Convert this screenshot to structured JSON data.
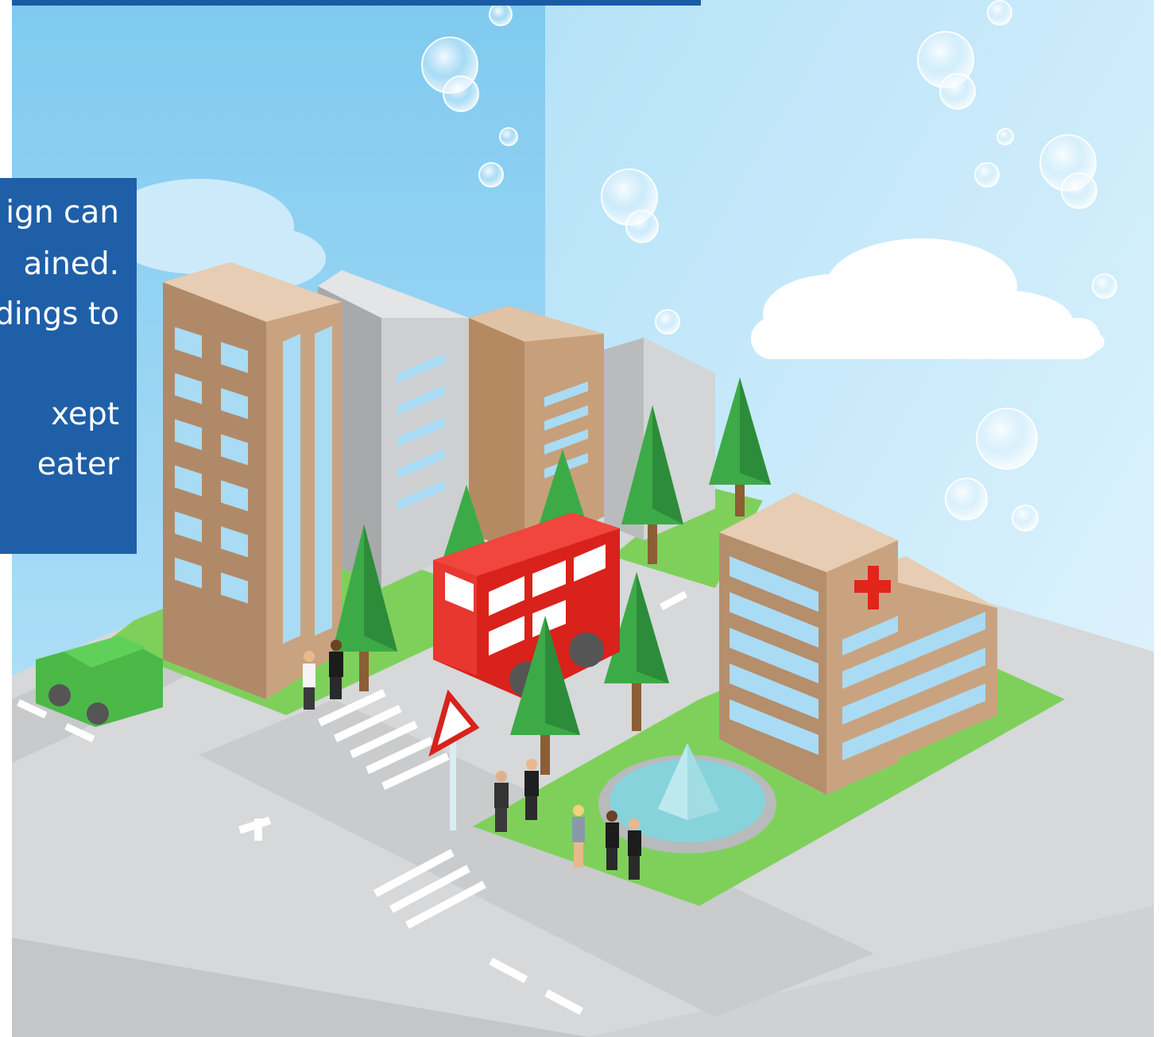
{
  "colors": {
    "sky_top": "#8fd2f2",
    "sky_bottom": "#d2eefb",
    "ground": "#d4d6d8",
    "ground_dark": "#bfc2c5",
    "road": "#c9cbcd",
    "grass": "#7dd05a",
    "bus_red": "#e32b23",
    "car_green": "#4cb848",
    "tree_green": "#3cab47",
    "building_tan": "#c49c78",
    "building_gray": "#cfd0d2",
    "window_blue": "#a8daf5",
    "text_box_blue": "#1f5fa8",
    "top_band_blue": "#1a5ba6",
    "cross_red": "#e1251b",
    "fountain_water": "#88d4dc"
  },
  "text_box": {
    "lines": [
      "ign can",
      "ained.",
      "dings to",
      "",
      "xept",
      "eater"
    ]
  },
  "icons": [
    "cloud-icon",
    "bubble-icon",
    "tree-icon",
    "bus-icon",
    "car-icon",
    "hospital-cross-icon",
    "warning-sign-icon",
    "fountain-icon",
    "person-icon"
  ]
}
